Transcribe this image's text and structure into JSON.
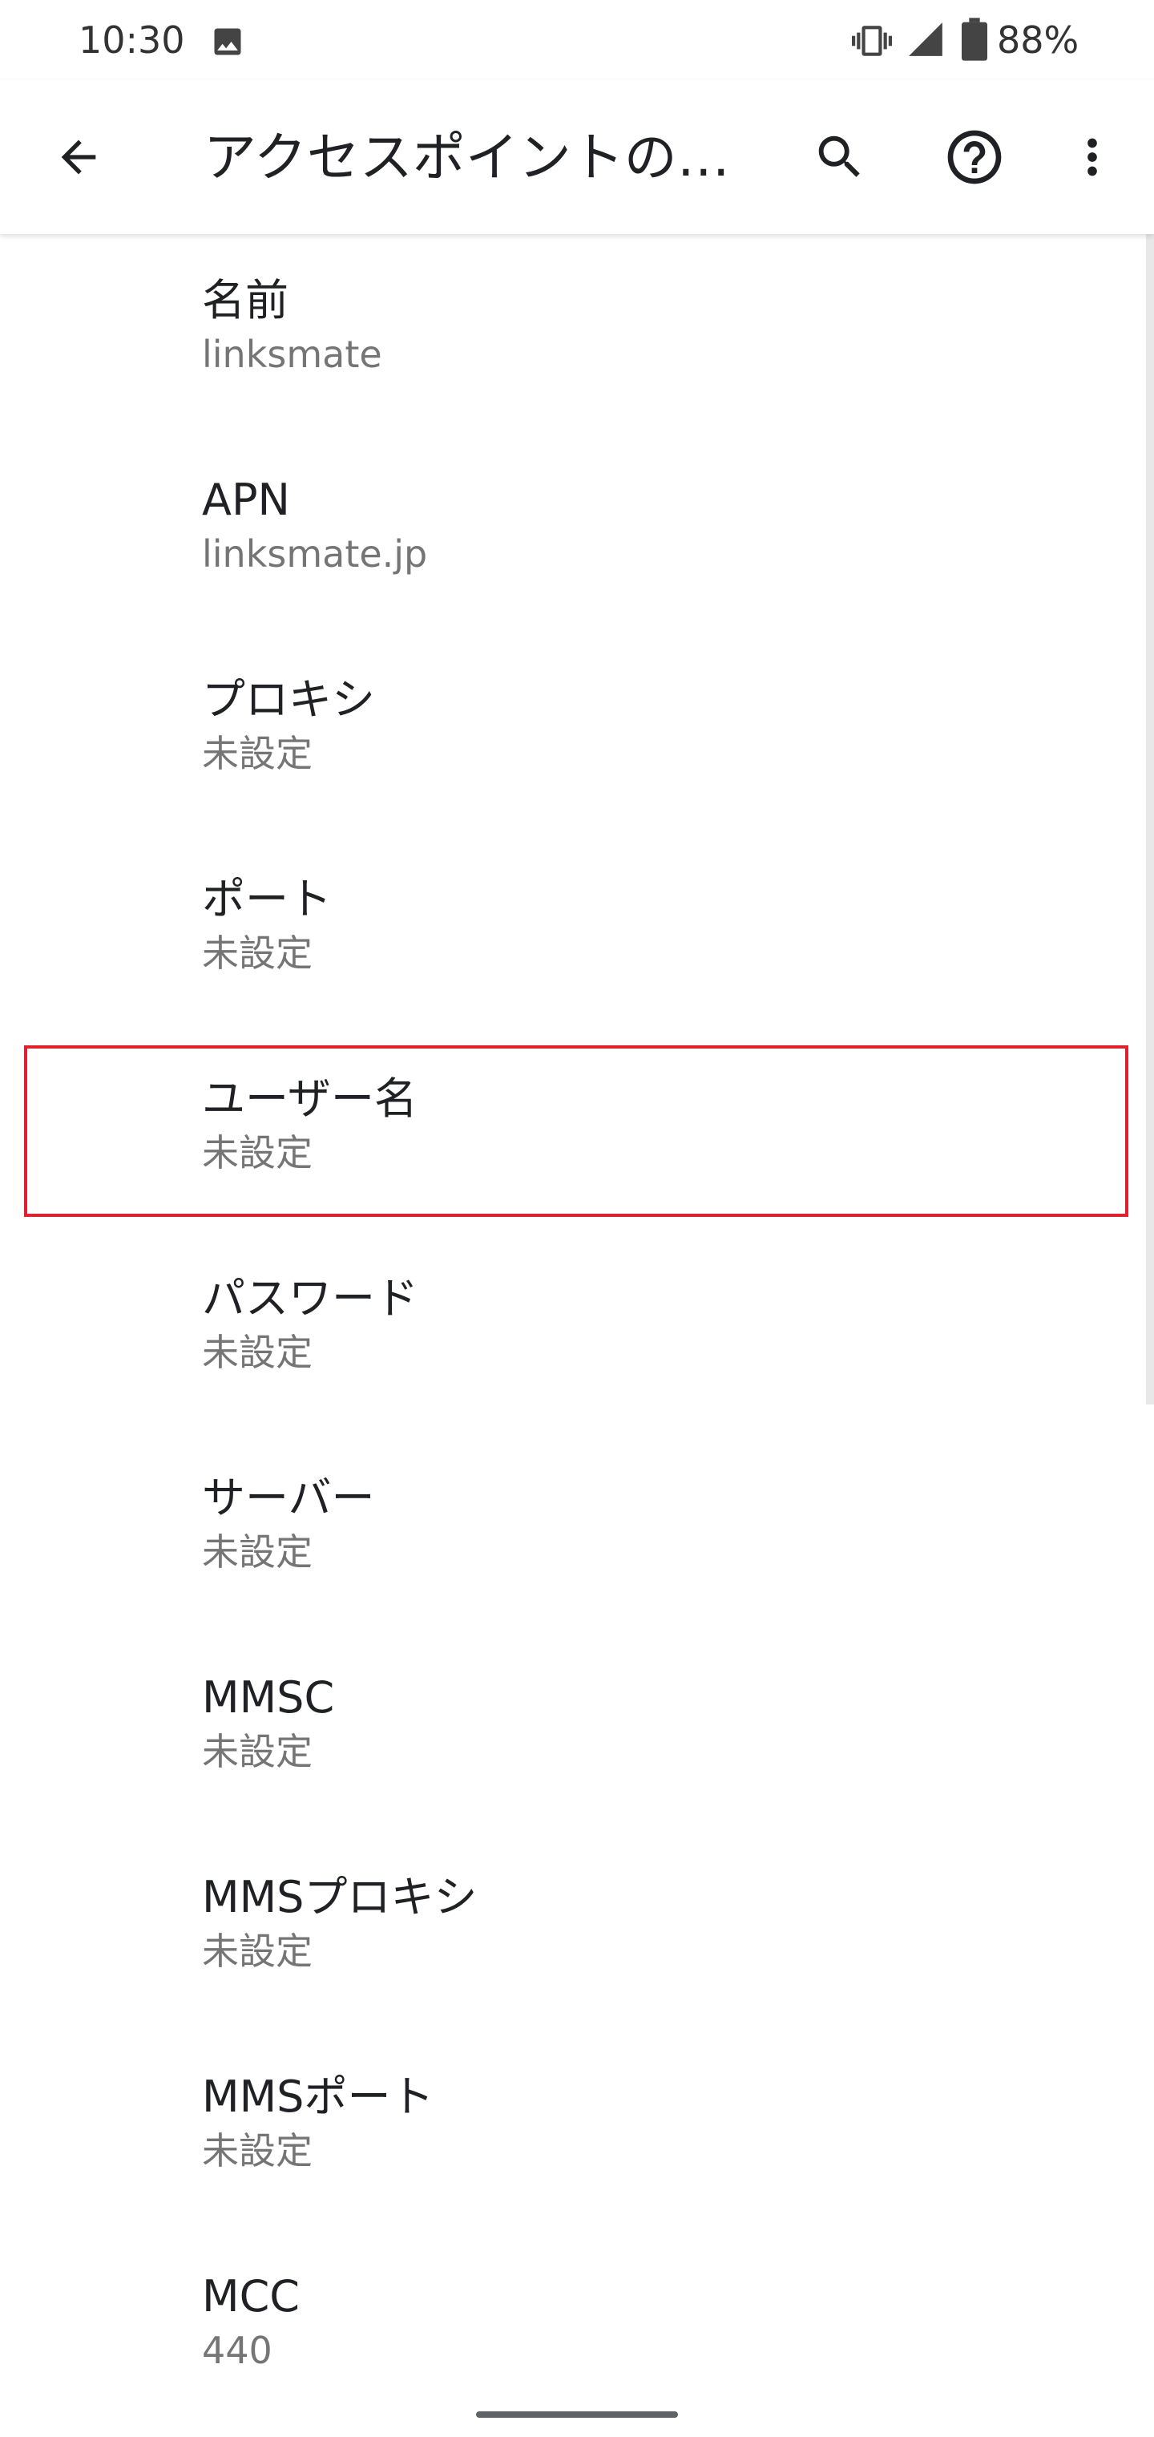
{
  "status_bar": {
    "time": "10:30",
    "battery": "88%",
    "icons": [
      "gallery-icon",
      "vibrate-icon",
      "signal-icon",
      "battery-icon"
    ]
  },
  "app_bar": {
    "title": "アクセスポイントの…",
    "icons": [
      "back-arrow-icon",
      "search-icon",
      "help-icon",
      "more-vert-icon"
    ]
  },
  "settings": [
    {
      "title": "名前",
      "summary": "linksmate"
    },
    {
      "title": "APN",
      "summary": "linksmate.jp"
    },
    {
      "title": "プロキシ",
      "summary": "未設定"
    },
    {
      "title": "ポート",
      "summary": "未設定"
    },
    {
      "title": "ユーザー名",
      "summary": "未設定"
    },
    {
      "title": "パスワード",
      "summary": "未設定"
    },
    {
      "title": "サーバー",
      "summary": "未設定"
    },
    {
      "title": "MMSC",
      "summary": "未設定"
    },
    {
      "title": "MMSプロキシ",
      "summary": "未設定"
    },
    {
      "title": "MMSポート",
      "summary": "未設定"
    },
    {
      "title": "MCC",
      "summary": "440"
    }
  ],
  "colors": {
    "highlight": "#e0202e",
    "text_primary": "#202124",
    "text_secondary": "#757575",
    "icon": "#202124"
  }
}
